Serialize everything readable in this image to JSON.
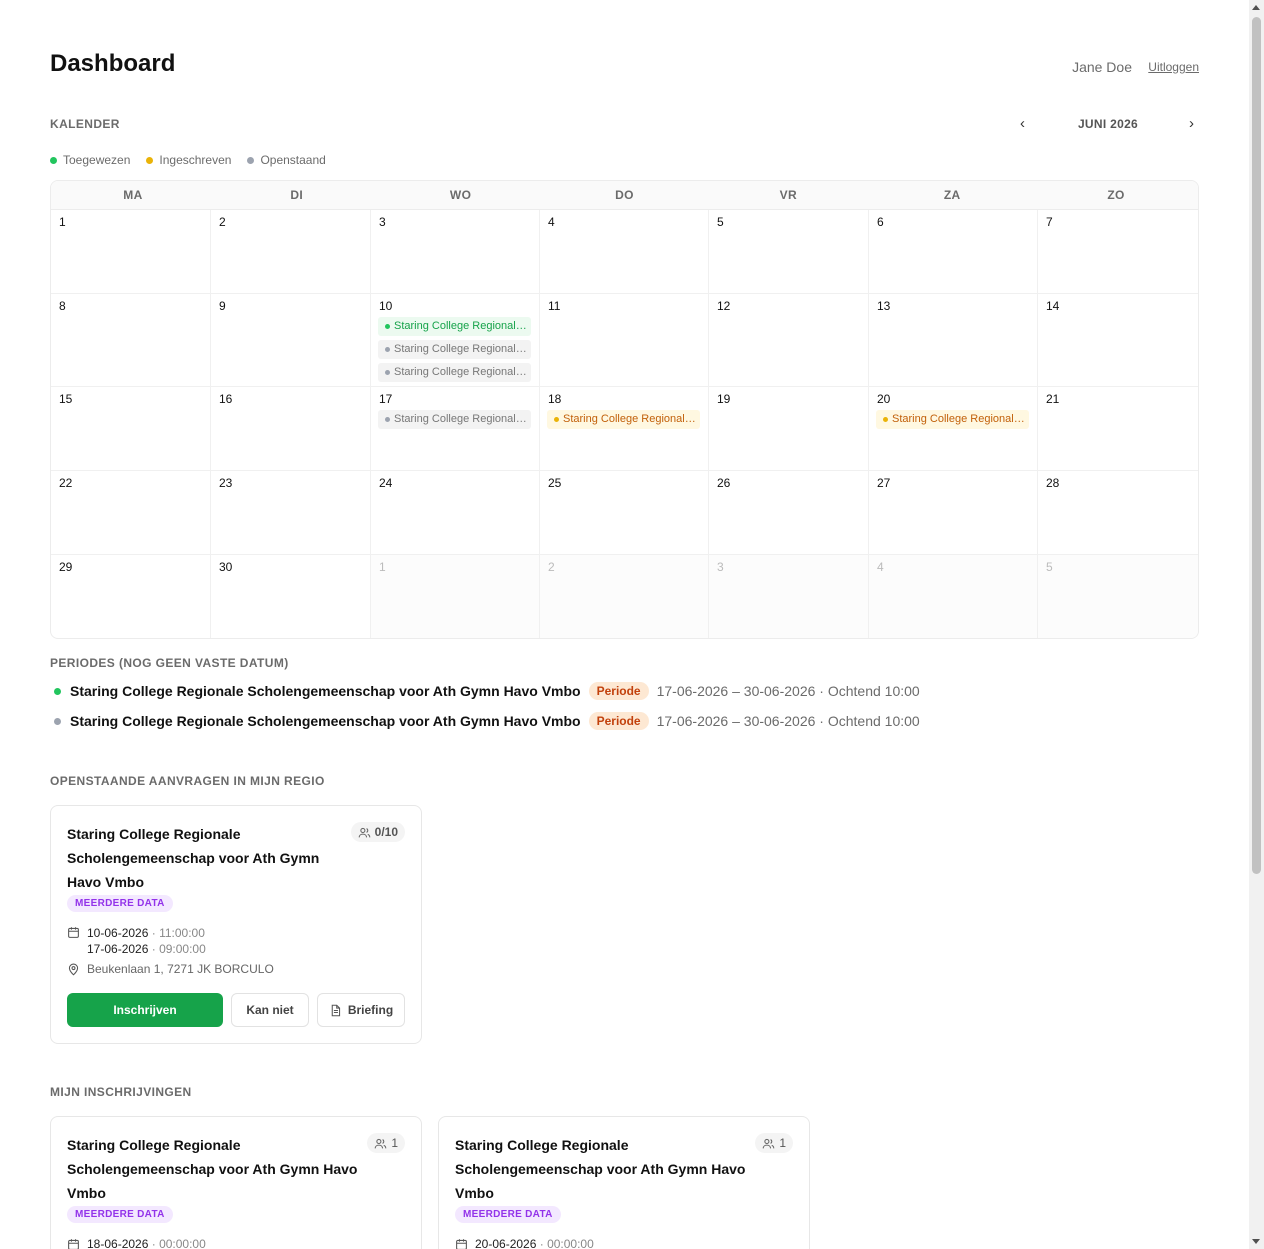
{
  "header": {
    "title": "Dashboard",
    "user_name": "Jane Doe",
    "logout_label": "Uitloggen"
  },
  "calendar": {
    "section_label": "KALENDER",
    "month_label": "JUNI 2026",
    "prev_icon": "‹",
    "next_icon": "›",
    "legend": [
      {
        "label": "Toegewezen",
        "color": "#22c55e"
      },
      {
        "label": "Ingeschreven",
        "color": "#eab308"
      },
      {
        "label": "Openstaand",
        "color": "#9ca3af"
      }
    ],
    "weekdays": [
      "MA",
      "DI",
      "WO",
      "DO",
      "VR",
      "ZA",
      "ZO"
    ],
    "weeks": [
      [
        {
          "day": "1"
        },
        {
          "day": "2"
        },
        {
          "day": "3"
        },
        {
          "day": "4"
        },
        {
          "day": "5"
        },
        {
          "day": "6"
        },
        {
          "day": "7"
        }
      ],
      [
        {
          "day": "8"
        },
        {
          "day": "9"
        },
        {
          "day": "10",
          "events": [
            {
              "text": "Staring College Regionale Scholengemeenschap voor Ath Gymn Havo Vmbo",
              "status": "green"
            },
            {
              "text": "Staring College Regionale Scholengemeenschap voor Ath Gymn Havo Vmbo",
              "status": "grey"
            },
            {
              "text": "Staring College Regionale Scholengemeenschap voor Ath Gymn Havo Vmbo",
              "status": "grey"
            }
          ]
        },
        {
          "day": "11"
        },
        {
          "day": "12"
        },
        {
          "day": "13"
        },
        {
          "day": "14"
        }
      ],
      [
        {
          "day": "15"
        },
        {
          "day": "16"
        },
        {
          "day": "17",
          "events": [
            {
              "text": "Staring College Regionale Scholengemeenschap voor Ath Gymn Havo Vmbo",
              "status": "grey"
            }
          ]
        },
        {
          "day": "18",
          "events": [
            {
              "text": "Staring College Regionale Scholengemeenschap voor Ath Gymn Havo Vmbo",
              "status": "yellow"
            }
          ]
        },
        {
          "day": "19"
        },
        {
          "day": "20",
          "events": [
            {
              "text": "Staring College Regionale Scholengemeenschap voor Ath Gymn Havo Vmbo",
              "status": "yellow"
            }
          ]
        },
        {
          "day": "21"
        }
      ],
      [
        {
          "day": "22"
        },
        {
          "day": "23"
        },
        {
          "day": "24"
        },
        {
          "day": "25"
        },
        {
          "day": "26"
        },
        {
          "day": "27"
        },
        {
          "day": "28"
        }
      ],
      [
        {
          "day": "29"
        },
        {
          "day": "30"
        },
        {
          "day": "1",
          "other": true
        },
        {
          "day": "2",
          "other": true
        },
        {
          "day": "3",
          "other": true
        },
        {
          "day": "4",
          "other": true
        },
        {
          "day": "5",
          "other": true
        }
      ]
    ]
  },
  "periods": {
    "section_label": "PERIODES (NOG GEEN VASTE DATUM)",
    "items": [
      {
        "name": "Staring College Regionale Scholengemeenschap voor Ath Gymn Havo Vmbo",
        "badge": "Periode",
        "meta": "17-06-2026 – 30-06-2026 · Ochtend 10:00",
        "color": "#22c55e"
      },
      {
        "name": "Staring College Regionale Scholengemeenschap voor Ath Gymn Havo Vmbo",
        "badge": "Periode",
        "meta": "17-06-2026 – 30-06-2026 · Ochtend 10:00",
        "color": "#9ca3af"
      }
    ]
  },
  "open_requests": {
    "section_label": "OPENSTAANDE AANVRAGEN IN MIJN REGIO",
    "card": {
      "title_lines": [
        "Staring College Regionale",
        "Scholengemeenschap voor Ath Gymn",
        "Havo Vmbo"
      ],
      "count": "0/10",
      "badge": "MEERDERE DATA",
      "dates": [
        {
          "date": "10-06-2026",
          "time": "· 11:00:00"
        },
        {
          "date": "17-06-2026",
          "time": "· 09:00:00"
        }
      ],
      "address": "Beukenlaan 1, 7271 JK BORCULO",
      "btn_signup": "Inschrijven",
      "btn_cant": "Kan niet",
      "btn_briefing": "Briefing"
    }
  },
  "my_signups": {
    "section_label": "MIJN INSCHRIJVINGEN",
    "cards": [
      {
        "title_lines": [
          "Staring College Regionale",
          "Scholengemeenschap voor Ath Gymn Havo",
          "Vmbo"
        ],
        "count": "1",
        "badge": "MEERDERE DATA",
        "date": "18-06-2026",
        "time": "· 00:00:00"
      },
      {
        "title_lines": [
          "Staring College Regionale",
          "Scholengemeenschap voor Ath Gymn Havo",
          "Vmbo"
        ],
        "count": "1",
        "badge": "MEERDERE DATA",
        "date": "20-06-2026",
        "time": "· 00:00:00"
      }
    ]
  }
}
